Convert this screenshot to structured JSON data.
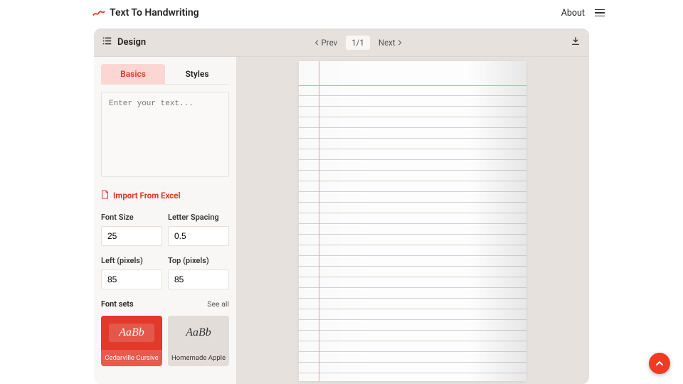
{
  "brand": {
    "title": "Text To Handwriting"
  },
  "nav": {
    "about": "About"
  },
  "designbar": {
    "title": "Design",
    "prev": "Prev",
    "page": "1/1",
    "next": "Next"
  },
  "tabs": {
    "basics": "Basics",
    "styles": "Styles"
  },
  "editor": {
    "placeholder": "Enter your text...",
    "value": ""
  },
  "import_label": "Import From Excel",
  "fields": {
    "font_size": {
      "label": "Font Size",
      "value": "25"
    },
    "letter_spacing": {
      "label": "Letter Spacing",
      "value": "0.5"
    },
    "left": {
      "label": "Left (pixels)",
      "value": "85"
    },
    "top": {
      "label": "Top (pixels)",
      "value": "85"
    }
  },
  "fontsets": {
    "title": "Font sets",
    "see_all": "See all",
    "sample": "AaBb",
    "items": [
      {
        "name": "Cedarville Cursive",
        "selected": true
      },
      {
        "name": "Homemade Apple",
        "selected": false
      }
    ]
  },
  "colors": {
    "accent": "#e13a2b"
  }
}
